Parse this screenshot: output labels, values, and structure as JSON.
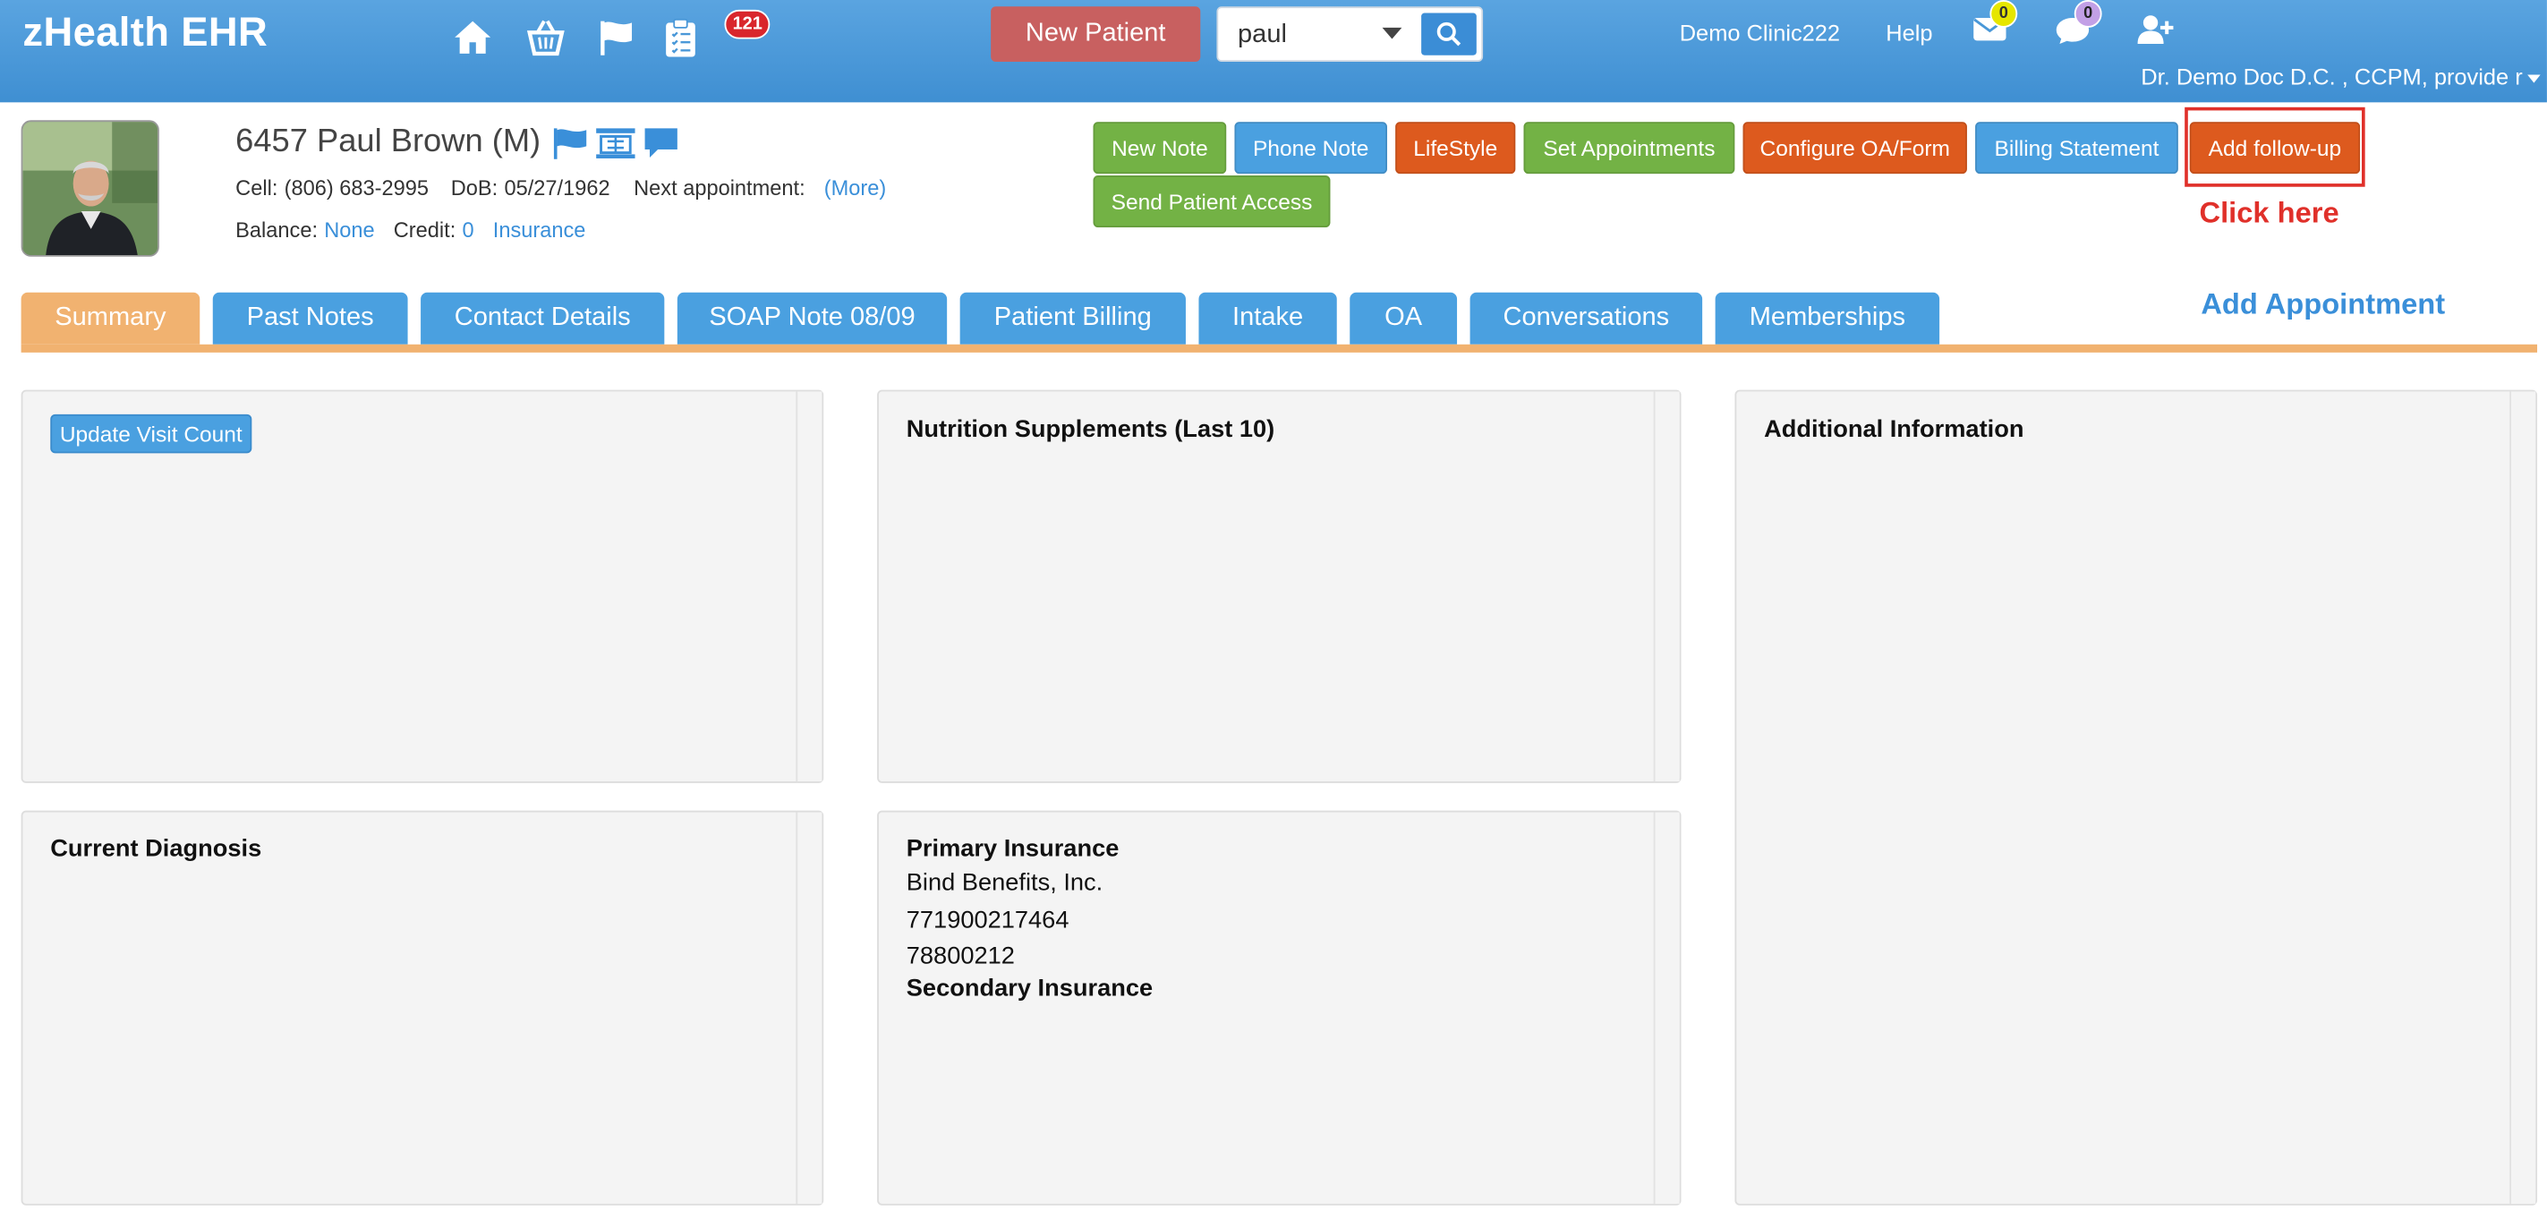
{
  "app": {
    "title": "zHealth EHR",
    "clipboard_badge": "121",
    "new_patient_label": "New Patient",
    "search_value": "paul",
    "clinic": "Demo Clinic222",
    "help": "Help",
    "mail_count": "0",
    "chat_count": "0",
    "user": "Dr. Demo Doc D.C. , CCPM, provide r"
  },
  "patient": {
    "name": "6457 Paul Brown (M)",
    "cell_label": "Cell:",
    "cell": "(806) 683-2995",
    "dob_label": "DoB:",
    "dob": "05/27/1962",
    "next_label": "Next appointment:",
    "more": "(More)",
    "balance_label": "Balance:",
    "balance": "None",
    "credit_label": "Credit:",
    "credit": "0",
    "insurance": "Insurance"
  },
  "actions": {
    "new_note": "New Note",
    "phone_note": "Phone Note",
    "lifestyle": "LifeStyle",
    "set_appointments": "Set Appointments",
    "configure_oa": "Configure OA/Form",
    "billing_statement": "Billing Statement",
    "add_followup": "Add follow-up",
    "send_access": "Send Patient Access",
    "click_here": "Click here",
    "add_appointment": "Add Appointment"
  },
  "tabs": [
    {
      "label": "Summary"
    },
    {
      "label": "Past Notes"
    },
    {
      "label": "Contact Details"
    },
    {
      "label": "SOAP Note 08/09"
    },
    {
      "label": "Patient Billing"
    },
    {
      "label": "Intake"
    },
    {
      "label": "OA"
    },
    {
      "label": "Conversations"
    },
    {
      "label": "Memberships"
    }
  ],
  "panels": {
    "update_visit": "Update Visit Count",
    "nutrition": "Nutrition Supplements (Last 10)",
    "additional": "Additional Information",
    "diagnosis": "Current Diagnosis",
    "primary_ins_title": "Primary Insurance",
    "primary_ins_lines": [
      "Bind Benefits, Inc.",
      "771900217464",
      "78800212"
    ],
    "secondary_ins_title": "Secondary Insurance"
  },
  "colors": {
    "topbar": "#4a98d8",
    "tab_active": "#f1b270",
    "tab": "#4aa0e0",
    "accent_red": "#e0302a"
  }
}
